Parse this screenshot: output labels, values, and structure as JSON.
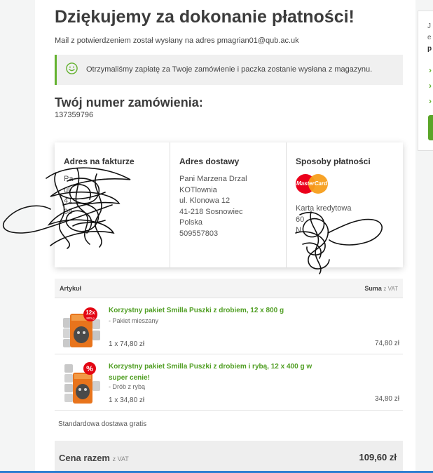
{
  "header": {
    "title": "Dziękujemy za dokonanie płatności!",
    "confirmation": "Mail z potwierdzeniem został wysłany na adres pmagrian01@qub.ac.uk"
  },
  "notice": {
    "icon": "smiley-icon",
    "text": "Otrzymaliśmy zapłatę za Twoje zamówienie i paczka zostanie wysłana z magazynu."
  },
  "order": {
    "heading": "Twój numer zamówienia:",
    "number": "137359796"
  },
  "billing": {
    "heading": "Adres na fakturze",
    "lines": [
      "Pa",
      "",
      "",
      "ul",
      "41",
      "08"
    ]
  },
  "delivery": {
    "heading": "Adres dostawy",
    "lines": [
      "Pani Marzena Drzal",
      "KOTlownia",
      "ul. Klonowa 12",
      "41-218 Sosnowiec",
      "Polska",
      "509557803"
    ]
  },
  "payment": {
    "heading": "Sposoby płatności",
    "card_brand": "MasterCard",
    "lines": [
      "Karta kredytowa",
      "60",
      "N"
    ]
  },
  "items_table": {
    "article_header": "Artykuł",
    "sum_header": "Suma",
    "sum_vat": "z VAT",
    "items": [
      {
        "name": "Korzystny pakiet Smilla Puszki z drobiem, 12 x 800 g",
        "variant": "- Pakiet mieszany",
        "quantity": "1 x 74,80 zł",
        "total": "74,80 zł",
        "badge": "12x",
        "badge_sub": "800 g"
      },
      {
        "name": "Korzystny pakiet Smilla Puszki z drobiem i rybą, 12 x 400 g w super cenie!",
        "variant": "- Drób z rybą",
        "quantity": "1 x 34,80 zł",
        "total": "34,80 zł",
        "badge": "%",
        "badge_sub": ""
      }
    ]
  },
  "shipping": "Standardowa dostawa gratis",
  "summary": {
    "label": "Cena razem",
    "vat": "z VAT",
    "total": "109,60 zł"
  },
  "side_panel": {
    "lines": [
      "J",
      "e",
      "p"
    ]
  },
  "colors": {
    "accent_green": "#64b22f",
    "product_green": "#4f9e22",
    "page_background": "#f4f5f5",
    "notice_background": "#f0f0f0"
  }
}
